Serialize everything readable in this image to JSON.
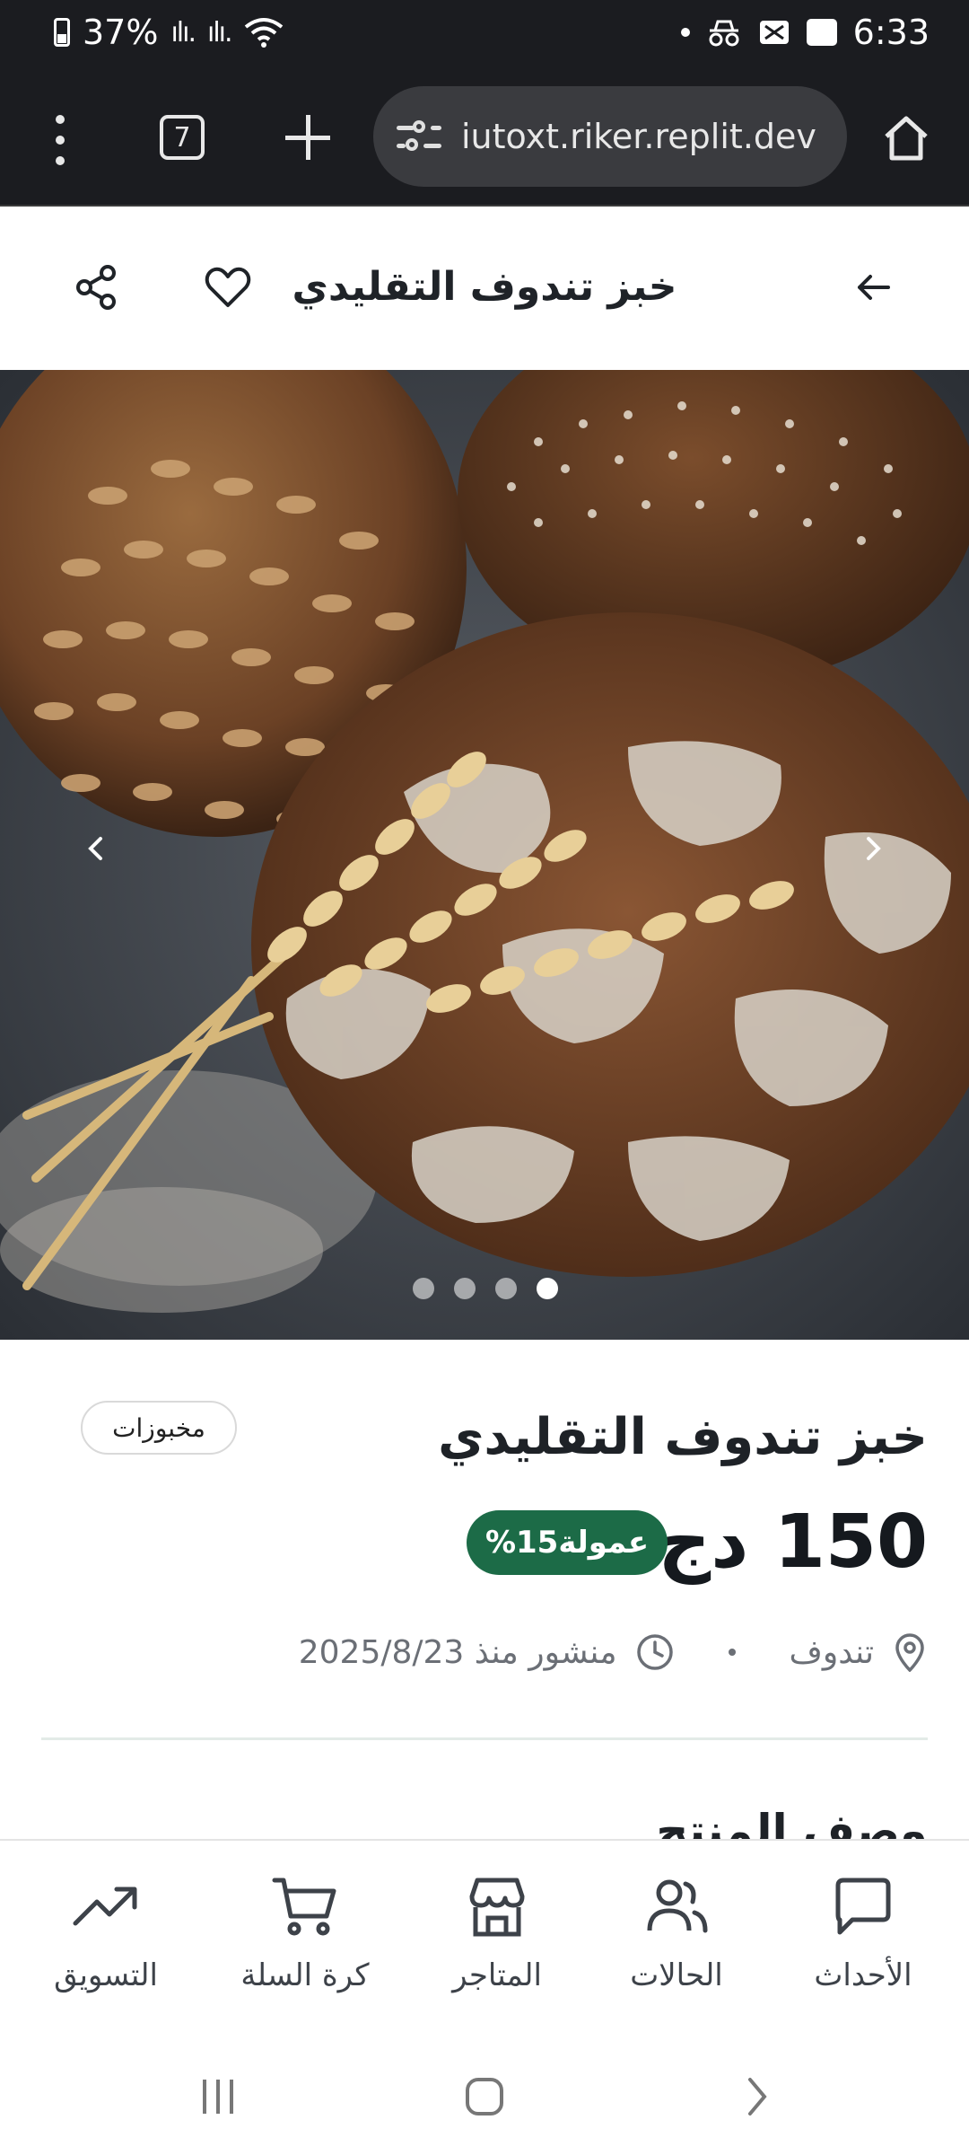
{
  "status_bar": {
    "battery": "37%",
    "time": "6:33"
  },
  "browser": {
    "tab_count": "7",
    "url": "iutoxt.riker.replit.dev"
  },
  "header": {
    "title": "خبز تندوف التقليدي"
  },
  "gallery": {
    "slide_count": 4,
    "active_index": 3
  },
  "product": {
    "category": "مخبوزات",
    "title": "خبز تندوف التقليدي",
    "price": "150 دج",
    "commission": "عمولة15%",
    "location": "تندوف",
    "published": "منشور منذ 2025/8/23",
    "section_heading": "وصف المنتج"
  },
  "bottom_nav": {
    "items": [
      {
        "label": "الأحداث",
        "icon": "chat-bubble-icon"
      },
      {
        "label": "الحالات",
        "icon": "users-icon"
      },
      {
        "label": "المتاجر",
        "icon": "store-icon"
      },
      {
        "label": "كرة السلة",
        "icon": "cart-icon"
      },
      {
        "label": "التسويق",
        "icon": "trending-up-icon"
      }
    ]
  },
  "colors": {
    "accent": "#1c6b47",
    "status_bar_bg": "#1b1c20",
    "text_dark": "#1e2227",
    "text_muted": "#6b6f76"
  }
}
